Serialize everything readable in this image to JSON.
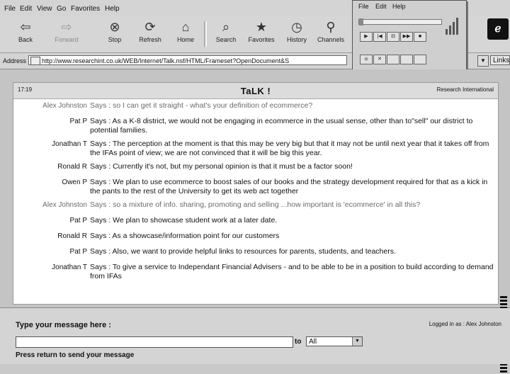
{
  "menu": [
    "File",
    "Edit",
    "View",
    "Go",
    "Favorites",
    "Help"
  ],
  "toolbar": [
    {
      "label": "Back",
      "icon": "back-arrow",
      "enabled": true
    },
    {
      "label": "Forward",
      "icon": "forward-arrow",
      "enabled": false
    },
    {
      "label": "Stop",
      "icon": "stop",
      "enabled": true
    },
    {
      "label": "Refresh",
      "icon": "refresh",
      "enabled": true
    },
    {
      "label": "Home",
      "icon": "home",
      "enabled": true
    },
    {
      "label": "Search",
      "icon": "search",
      "enabled": true
    },
    {
      "label": "Favorites",
      "icon": "favorites",
      "enabled": true
    },
    {
      "label": "History",
      "icon": "history",
      "enabled": true
    },
    {
      "label": "Channels",
      "icon": "channels",
      "enabled": true
    }
  ],
  "address": {
    "label": "Address",
    "url": "http://www.researchint.co.uk/WEB/Internet/Talk.nsf/HTML/Frameset?OpenDocument&S",
    "links_label": "Links"
  },
  "player": {
    "menu": [
      "File",
      "Edit",
      "Help"
    ],
    "controls": [
      "▶",
      "|◀",
      "⊟",
      "▶▶",
      "■"
    ],
    "controls2": [
      "◉",
      "✕",
      "",
      "",
      ""
    ]
  },
  "talk": {
    "time": "17:19",
    "title": "TaLK !",
    "org": "Research International",
    "messages": [
      {
        "who": "Alex Johnston",
        "says": "Says : so I can get it straight - what's your definition of ecommerce?",
        "moderator": true
      },
      {
        "who": "Pat P",
        "says": "Says : As a K-8 district, we would not be engaging in ecommerce in the usual sense, other than to\"sell\" our district to potential families.",
        "moderator": false
      },
      {
        "who": "Jonathan T",
        "says": "Says : The perception at the moment is that this may be very big but that it may not be until next year that it takes off from the IFAs point of view; we are not convinced that it will be big this year.",
        "moderator": false
      },
      {
        "who": "Ronald R",
        "says": "Says : Currently it's not, but my personal opinion is that it must be a factor soon!",
        "moderator": false
      },
      {
        "who": "Owen P",
        "says": "Says : We plan to use ecommerce to boost sales of our books and the strategy development required for that as a kick in the pants to the rest of the University to get its web act together",
        "moderator": false
      },
      {
        "who": "Alex Johnston",
        "says": "Says : so a mixture of info. sharing, promoting and selling ...how important is 'ecommerce' in all this?",
        "moderator": true
      },
      {
        "who": "Pat P",
        "says": "Says : We plan to showcase student work at a later date.",
        "moderator": false
      },
      {
        "who": "Ronald R",
        "says": "Says : As a showcase/information point for our customers",
        "moderator": false
      },
      {
        "who": "Pat P",
        "says": "Says : Also, we want to provide helpful links to resources for parents, students, and teachers.",
        "moderator": false
      },
      {
        "who": "Jonathan T",
        "says": "Says : To give a service to Independant Financial Advisers - and to be able to be in a position to build according to demand from IFAs",
        "moderator": false
      }
    ]
  },
  "compose": {
    "prompt": "Type your message here :",
    "logged_in": "Logged in as : Alex Johnston",
    "to_label": "to",
    "recipient": "All",
    "hint": "Press return to send your message"
  },
  "colors": {
    "moderator_text": "#6a6a6a",
    "chrome": "#d4d4d4"
  }
}
